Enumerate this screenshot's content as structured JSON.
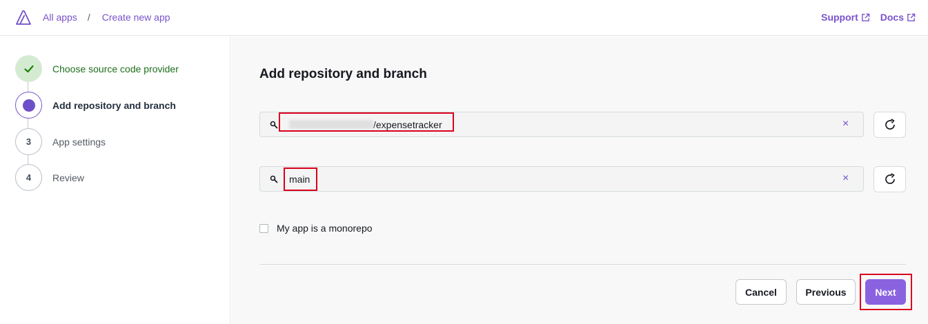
{
  "header": {
    "breadcrumbs": [
      "All apps",
      "Create new app"
    ],
    "separator": "/",
    "links": [
      "Support",
      "Docs"
    ]
  },
  "steps": [
    {
      "number": "",
      "label": "Choose source code provider",
      "status": "complete"
    },
    {
      "number": "",
      "label": "Add repository and branch",
      "status": "current"
    },
    {
      "number": "3",
      "label": "App settings",
      "status": "pending"
    },
    {
      "number": "4",
      "label": "Review",
      "status": "pending"
    }
  ],
  "main": {
    "title": "Add repository and branch",
    "repository": {
      "value": "/expensetracker"
    },
    "branch": {
      "value": "main"
    },
    "monorepo_label": "My app is a monorepo",
    "buttons": {
      "cancel": "Cancel",
      "previous": "Previous",
      "next": "Next"
    }
  },
  "colors": {
    "accent": "#7a52cc",
    "primary_button": "#8a62e0",
    "highlight": "#d9001b",
    "complete_step_bg": "#d4ebd2"
  }
}
